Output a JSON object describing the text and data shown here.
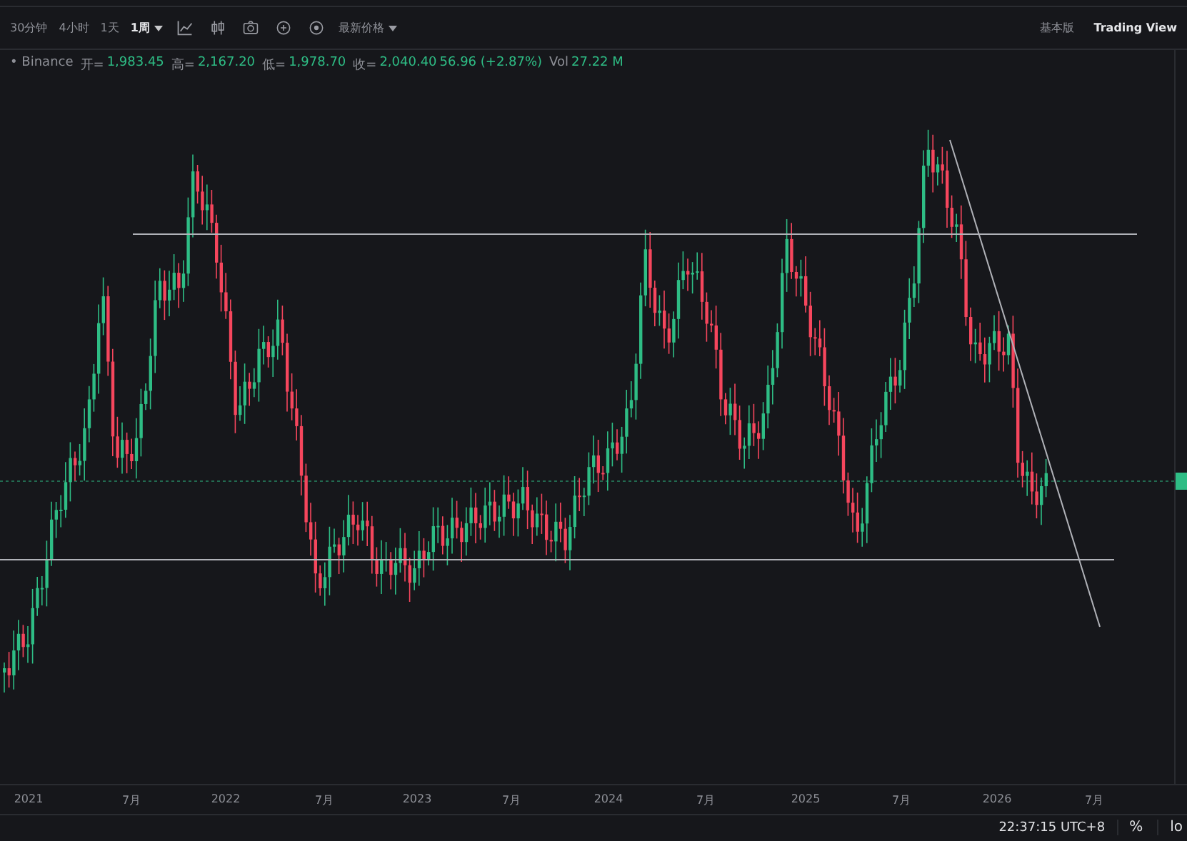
{
  "toolbar": {
    "intervals": [
      {
        "label": "30分钟",
        "selected": false
      },
      {
        "label": "4小时",
        "selected": false
      },
      {
        "label": "1天",
        "selected": false
      },
      {
        "label": "1周",
        "selected": true
      }
    ],
    "price_type": "最新价格",
    "views": [
      {
        "label": "基本版",
        "selected": false
      },
      {
        "label": "Trading View",
        "selected": true
      }
    ]
  },
  "legend": {
    "symbol": "• Binance",
    "items": [
      {
        "label": "开=",
        "value": "1,983.45"
      },
      {
        "label": "高=",
        "value": "2,167.20"
      },
      {
        "label": "低=",
        "value": "1,978.70"
      },
      {
        "label": "收=",
        "value": "2,040.40"
      }
    ],
    "change": "56.96 (+2.87%)",
    "volume_label": "Vol",
    "volume": "27.22 M"
  },
  "x_axis": [
    "2021",
    "7月",
    "2022",
    "7月",
    "2023",
    "7月",
    "2024",
    "7月",
    "2025",
    "7月",
    "2026",
    "7月"
  ],
  "status_bar": {
    "time": "22:37:15 UTC+8",
    "percent": "%",
    "log": "lo"
  }
}
